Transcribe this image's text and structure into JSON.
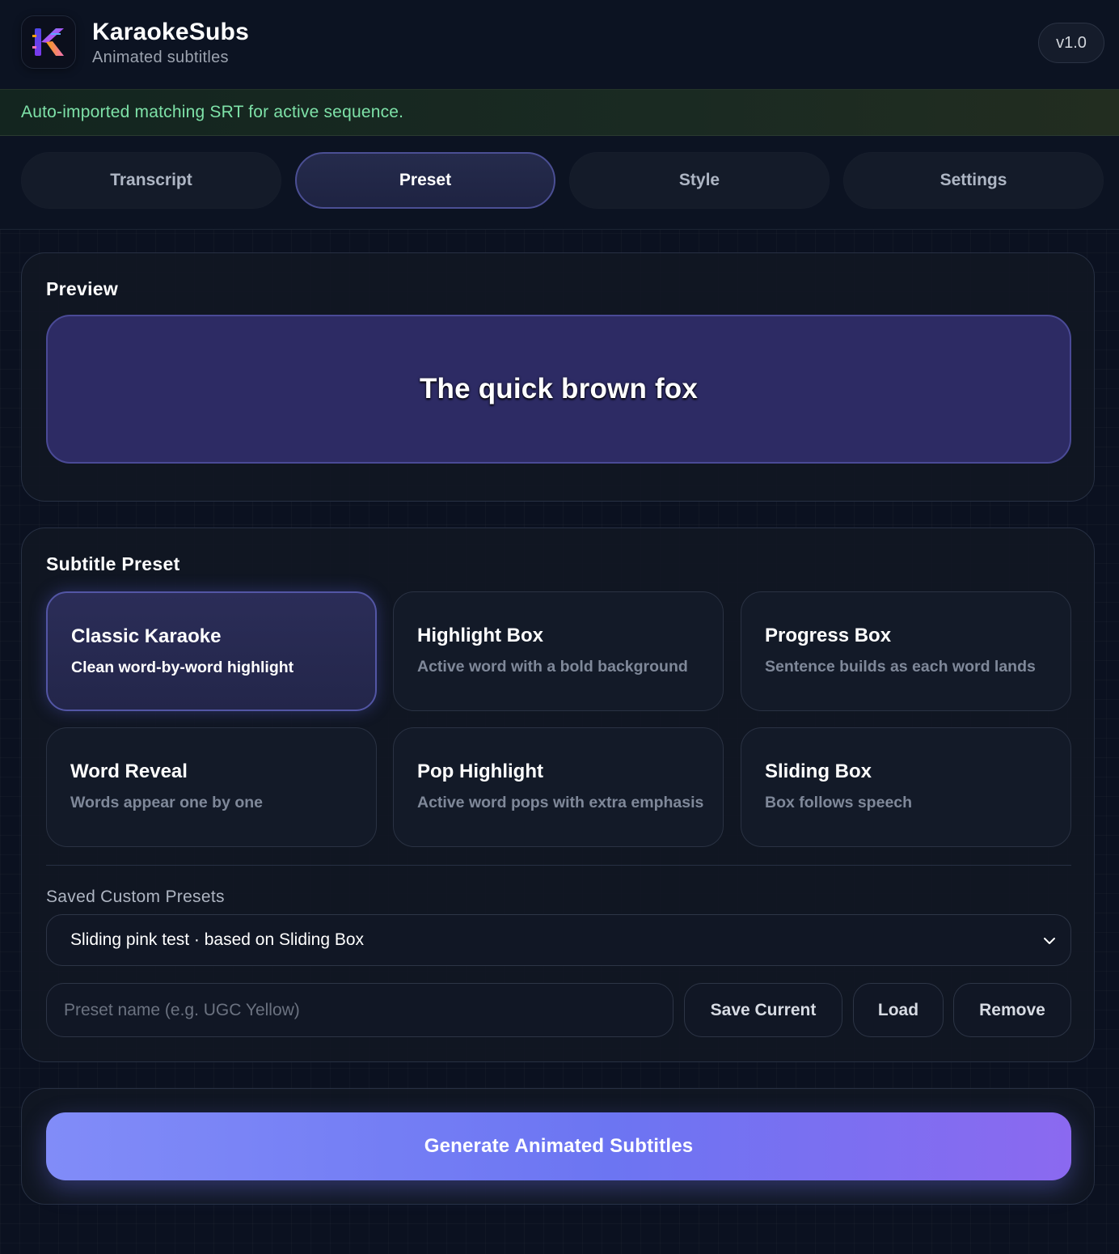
{
  "header": {
    "app_name": "KaraokeSubs",
    "app_subtitle": "Animated subtitles",
    "version": "v1.0",
    "logo_letter": "K"
  },
  "banner": {
    "message": "Auto-imported matching SRT for active sequence.",
    "color": "#7ee2a8"
  },
  "tabs": [
    {
      "label": "Transcript",
      "active": false
    },
    {
      "label": "Preset",
      "active": true
    },
    {
      "label": "Style",
      "active": false
    },
    {
      "label": "Settings",
      "active": false
    }
  ],
  "preview": {
    "title": "Preview",
    "sample_text": "The quick brown fox",
    "background_color": "#2d2b64"
  },
  "subtitle_preset": {
    "title": "Subtitle Preset",
    "presets": [
      {
        "name": "Classic Karaoke",
        "description": "Clean word-by-word highlight",
        "selected": true
      },
      {
        "name": "Highlight Box",
        "description": "Active word with a bold background",
        "selected": false
      },
      {
        "name": "Progress Box",
        "description": "Sentence builds as each word lands",
        "selected": false
      },
      {
        "name": "Word Reveal",
        "description": "Words appear one by one",
        "selected": false
      },
      {
        "name": "Pop Highlight",
        "description": "Active word pops with extra emphasis",
        "selected": false
      },
      {
        "name": "Sliding Box",
        "description": "Box follows speech",
        "selected": false
      }
    ],
    "saved_label": "Saved Custom Presets",
    "saved_selected": "Sliding pink test · based on Sliding Box",
    "name_input": {
      "value": "",
      "placeholder": "Preset name (e.g. UGC Yellow)"
    },
    "buttons": {
      "save": "Save Current",
      "load": "Load",
      "remove": "Remove"
    }
  },
  "generate": {
    "label": "Generate Animated Subtitles",
    "accent": "#6c75f2"
  }
}
